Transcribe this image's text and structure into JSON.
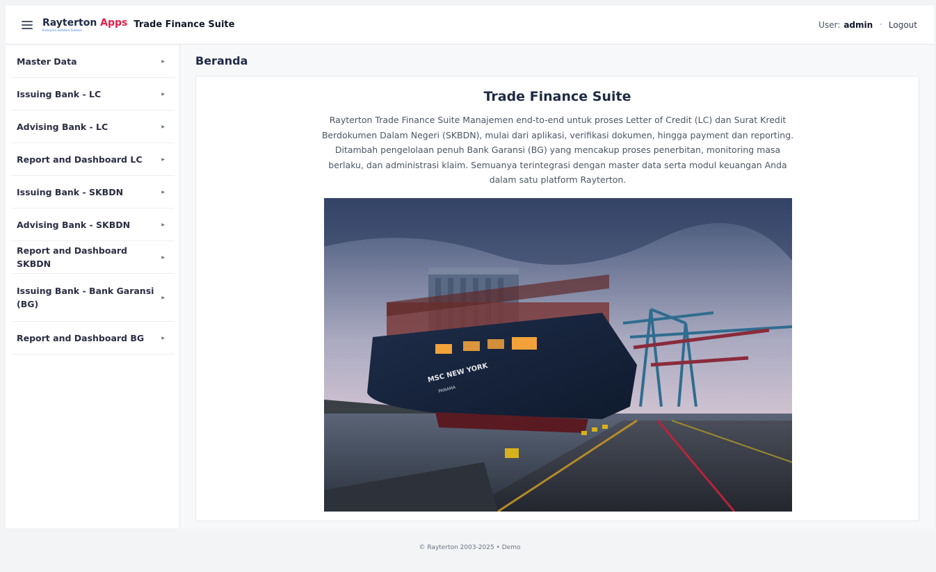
{
  "header": {
    "brand_main": "Rayterton",
    "brand_accent": "Apps",
    "brand_tagline": "Enterprise Software Solution",
    "app_title": "Trade Finance Suite",
    "user_label": "User:",
    "username": "admin",
    "separator": "•",
    "logout_label": "Logout"
  },
  "sidebar": {
    "items": [
      {
        "label": "Master Data"
      },
      {
        "label": "Issuing Bank - LC"
      },
      {
        "label": "Advising Bank - LC"
      },
      {
        "label": "Report and Dashboard LC"
      },
      {
        "label": "Issuing Bank - SKBDN"
      },
      {
        "label": "Advising Bank - SKBDN"
      },
      {
        "label": "Report and Dashboard SKBDN"
      },
      {
        "label": "Issuing Bank - Bank Garansi (BG)"
      },
      {
        "label": "Report and Dashboard BG"
      }
    ]
  },
  "main": {
    "page_title": "Beranda",
    "card_title": "Trade Finance Suite",
    "description": "Rayterton Trade Finance Suite Manajemen end-to-end untuk proses Letter of Credit (LC) dan Surat Kredit Berdokumen Dalam Negeri (SKBDN), mulai dari aplikasi, verifikasi dokumen, hingga payment dan reporting. Ditambah pengelolaan penuh Bank Garansi (BG) yang mencakup proses penerbitan, monitoring masa berlaku, dan administrasi klaim. Semuanya terintegrasi dengan master data serta modul keuangan Anda dalam satu platform Rayterton.",
    "hero_ship_name": "MSC NEW YORK",
    "hero_ship_port": "PANAMA"
  },
  "footer": {
    "text": "© Rayterton 2003-2025 • Demo"
  },
  "colors": {
    "accent": "#e11d48",
    "brand_dark": "#1f2a44"
  }
}
